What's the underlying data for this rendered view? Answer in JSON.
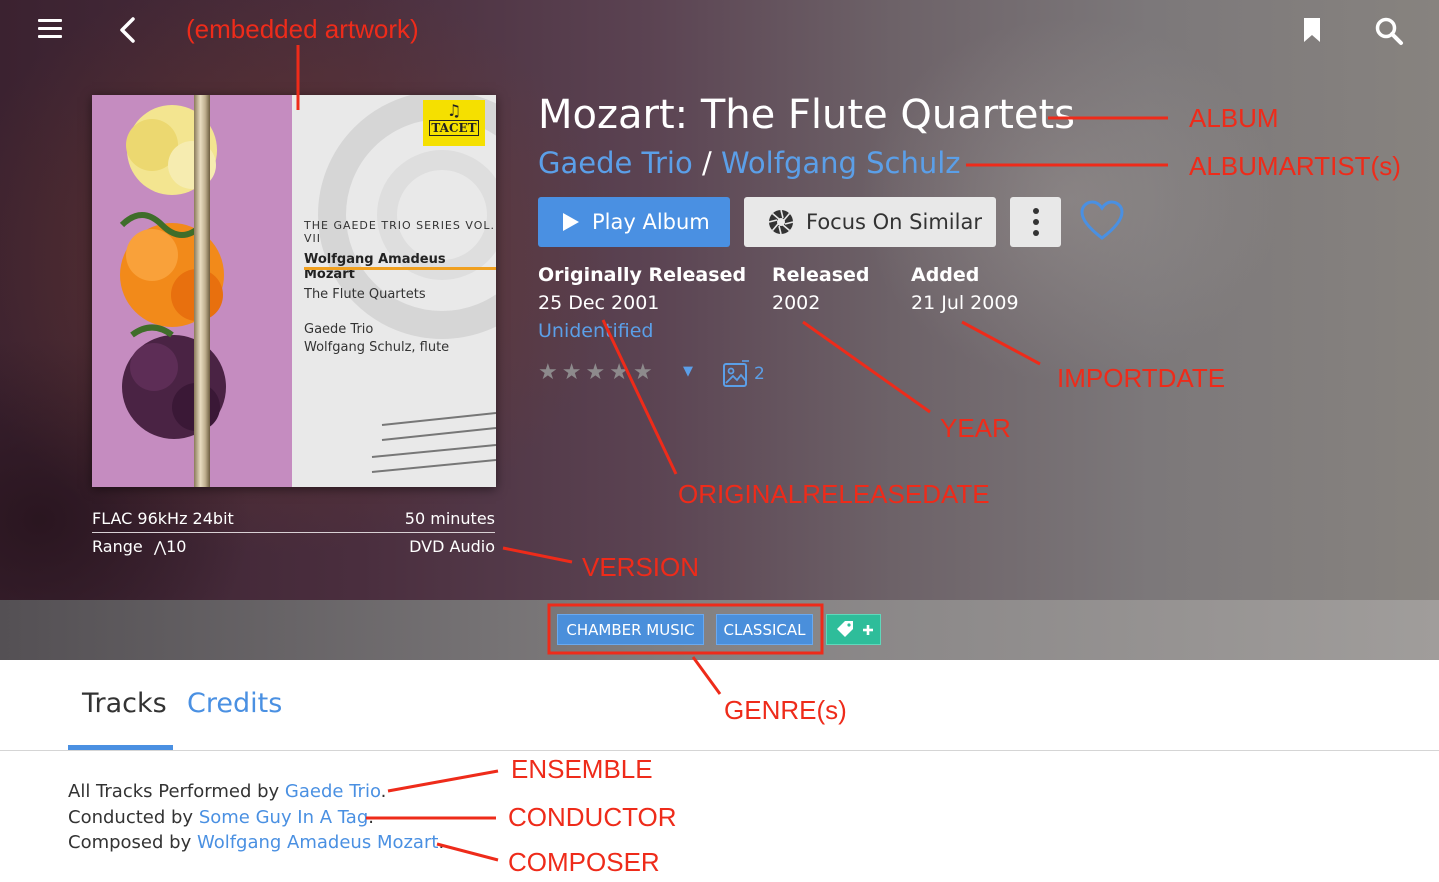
{
  "album": {
    "title": "Mozart: The Flute Quartets",
    "artists": [
      "Gaede Trio",
      "Wolfgang Schulz"
    ],
    "artist_separator": " / ",
    "format": "FLAC 96kHz 24bit",
    "duration": "50 minutes",
    "range_label": "Range",
    "range_value": "10",
    "version": "DVD Audio",
    "artwork_count": "2",
    "rating_stars": 0
  },
  "cover": {
    "logo": "TACET",
    "series": "The Gaede Trio Series Vol. VII",
    "composer": "Wolfgang Amadeus Mozart",
    "work": "The Flute Quartets",
    "performer1": "Gaede Trio",
    "performer2": "Wolfgang Schulz, flute"
  },
  "actions": {
    "play_label": "Play Album",
    "focus_label": "Focus On Similar"
  },
  "meta": {
    "orig_label": "Originally Released",
    "orig_value": "25 Dec 2001",
    "released_label": "Released",
    "released_value": "2002",
    "added_label": "Added",
    "added_value": "21 Jul 2009",
    "identification": "Unidentified"
  },
  "genres": [
    "CHAMBER MUSIC",
    "CLASSICAL"
  ],
  "tabs": [
    {
      "label": "Tracks"
    },
    {
      "label": "Credits"
    }
  ],
  "credits": {
    "ensemble_prefix": "All Tracks Performed by ",
    "ensemble": "Gaede Trio",
    "conductor_prefix": "Conducted by ",
    "conductor": "Some Guy In A Tag",
    "composer_prefix": "Composed by ",
    "composer": "Wolfgang Amadeus Mozart",
    "suffix": "."
  },
  "annotations": {
    "artwork": "(embedded artwork)",
    "album": "ALBUM",
    "albumartist": "ALBUMARTIST(s)",
    "importdate": "IMPORTDATE",
    "year": "YEAR",
    "originalreleasedate": "ORIGINALRELEASEDATE",
    "version": "VERSION",
    "genre": "GENRE(s)",
    "ensemble": "ENSEMBLE",
    "conductor": "CONDUCTOR",
    "composer": "COMPOSER"
  },
  "colors": {
    "accent": "#4a90e2",
    "link": "#5b9fe8",
    "annotation": "#ee2b1a",
    "tag_add": "#2ebd9a"
  }
}
